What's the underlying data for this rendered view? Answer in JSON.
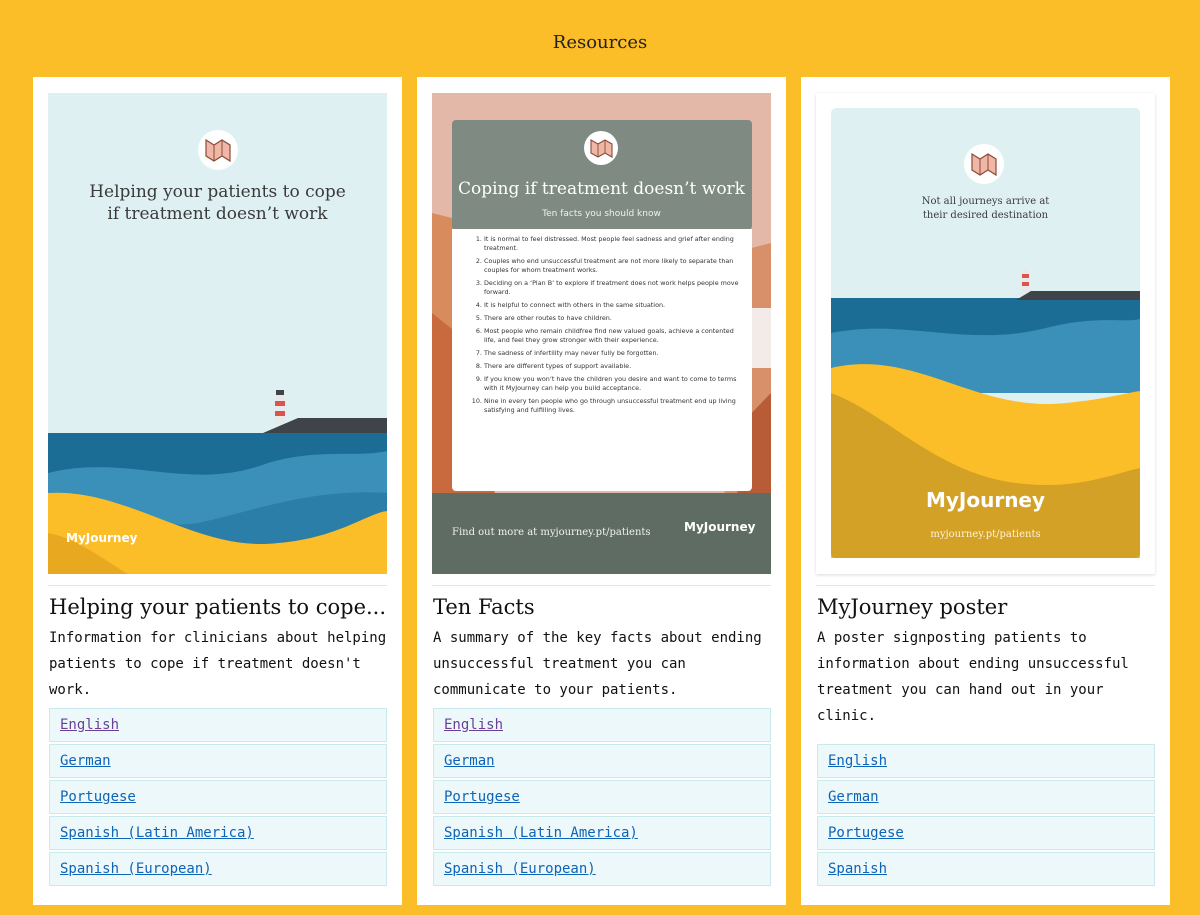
{
  "page": {
    "heading": "Resources"
  },
  "cards": [
    {
      "poster": {
        "headline": "Helping your patients to cope if treatment doesn’t work",
        "brand": "MyJourney"
      },
      "title": "Helping your patients to cope...",
      "description": "Information for clinicians about helping patients to cope if treatment doesn't work.",
      "links": [
        "English",
        "German",
        "Portugese",
        "Spanish (Latin America)",
        "Spanish (European)"
      ]
    },
    {
      "poster": {
        "headline": "Coping if treatment doesn’t work",
        "subheadline": "Ten facts you should know",
        "facts": [
          "It is normal to feel distressed. Most people feel sadness and grief after ending treatment.",
          "Couples who end unsuccessful treatment are not more likely to separate than couples for whom treatment works.",
          "Deciding on a ‘Plan B’ to explore if treatment does not work helps people move forward.",
          "It is helpful to connect with others in the same situation.",
          "There are other routes to have children.",
          "Most people who remain childfree find new valued goals, achieve a contented life, and feel they grow stronger with their experience.",
          "The sadness of infertility may never fully be forgotten.",
          "There are different types of support available.",
          "If you know you won’t have the children you desire and want to come to terms with it MyJourney can help you build acceptance.",
          "Nine in every ten people who go through unsuccessful treatment end up living satisfying and fulfilling lives."
        ],
        "footer": "Find out more at myjourney.pt/patients",
        "brand": "MyJourney"
      },
      "title": "Ten Facts",
      "description": "A summary of the key facts about ending unsuccessful treatment you can communicate to your patients.",
      "links": [
        "English",
        "German",
        "Portugese",
        "Spanish (Latin America)",
        "Spanish (European)"
      ]
    },
    {
      "poster": {
        "headline": "Not all journeys arrive at their desired destination",
        "brand": "MyJourney",
        "url": "myjourney.pt/patients"
      },
      "title": "MyJourney poster",
      "description": "A poster signposting patients to information about ending unsuccessful treatment you can hand out in your clinic.",
      "links": [
        "English",
        "German",
        "Portugese",
        "Spanish"
      ]
    }
  ],
  "colors": {
    "background": "#fbbd28",
    "link": "#0e64b8",
    "visited_link": "#6b3f98",
    "link_row": "#ecf8f9"
  }
}
